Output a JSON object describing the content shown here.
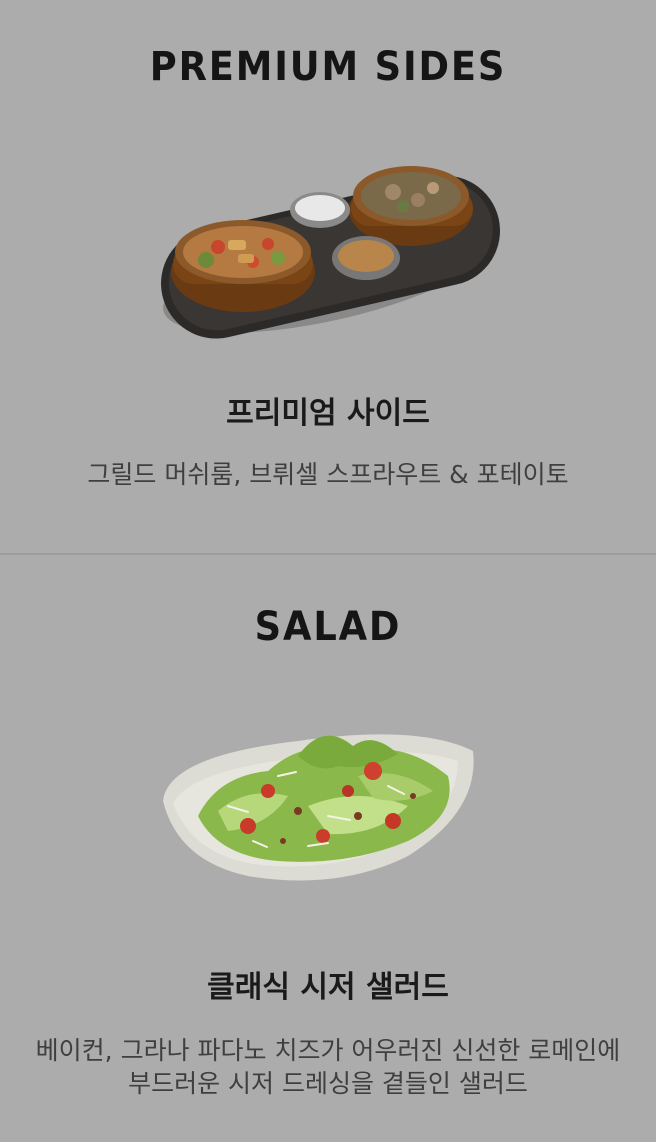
{
  "premium_sides": {
    "heading": "PREMIUM SIDES",
    "item_title": "프리미엄 사이드",
    "item_desc": "그릴드 머쉬룸, 브뤼셀 스프라우트 & 포테이토"
  },
  "salad": {
    "heading": "SALAD",
    "item_title": "클래식 시저 샐러드",
    "item_desc_line1": "베이컨, 그라나 파다노 치즈가 어우러진 신선한 로메인에",
    "item_desc_line2": "부드러운 시저 드레싱을 곁들인 샐러드"
  }
}
